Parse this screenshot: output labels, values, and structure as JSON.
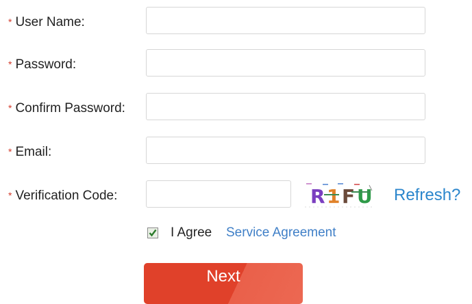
{
  "form": {
    "required_marker": "*",
    "fields": [
      {
        "label": "User Name:",
        "value": "",
        "placeholder": ""
      },
      {
        "label": "Password:",
        "value": "",
        "placeholder": ""
      },
      {
        "label": "Confirm Password:",
        "value": "",
        "placeholder": ""
      },
      {
        "label": "Email:",
        "value": "",
        "placeholder": ""
      },
      {
        "label": "Verification Code:",
        "value": "",
        "placeholder": ""
      }
    ],
    "captcha": {
      "chars": [
        {
          "char": "R",
          "color": "#7b3fc0"
        },
        {
          "char": "1",
          "color": "#e0822a"
        },
        {
          "char": "F",
          "color": "#6b4a3a"
        },
        {
          "char": "U",
          "color": "#2e9a48"
        }
      ]
    },
    "refresh_label": "Refresh?",
    "agree": {
      "checked": true,
      "text": "I Agree",
      "link": "Service Agreement"
    },
    "next_label": "Next"
  },
  "colors": {
    "required": "#d23a2a",
    "link": "#2b86cc",
    "button": "#e0412a"
  }
}
